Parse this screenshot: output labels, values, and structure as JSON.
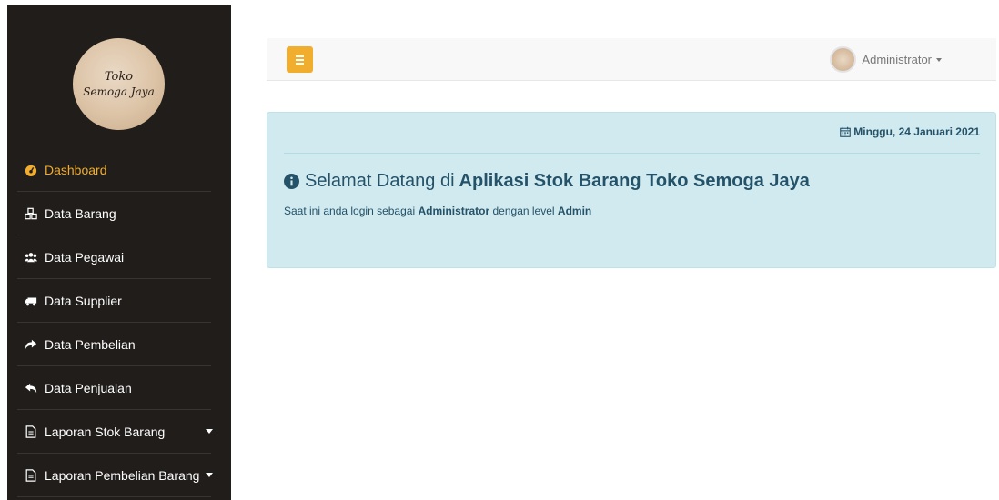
{
  "app": {
    "logo_line1": "Toko",
    "logo_line2": "Semoga Jaya"
  },
  "sidebar": {
    "items": [
      {
        "label": "Dashboard",
        "icon": "dashboard-icon",
        "active": true
      },
      {
        "label": "Data Barang",
        "icon": "cubes-icon"
      },
      {
        "label": "Data Pegawai",
        "icon": "users-icon"
      },
      {
        "label": "Data Supplier",
        "icon": "truck-icon"
      },
      {
        "label": "Data Pembelian",
        "icon": "share-icon"
      },
      {
        "label": "Data Penjualan",
        "icon": "reply-icon"
      },
      {
        "label": "Laporan Stok Barang",
        "icon": "file-icon",
        "dropdown": true
      },
      {
        "label": "Laporan Pembelian Barang",
        "icon": "file-icon",
        "dropdown": true
      }
    ]
  },
  "topbar": {
    "user_name": "Administrator"
  },
  "main": {
    "date": "Minggu, 24 Januari 2021",
    "welcome_prefix": "Selamat Datang di",
    "welcome_app": "Aplikasi Stok Barang Toko Semoga Jaya",
    "login_prefix": "Saat ini anda login sebagai",
    "login_user": "Administrator",
    "login_mid": "dengan level",
    "login_level": "Admin"
  },
  "colors": {
    "sidebar_bg": "#211d1b",
    "accent": "#f0ad2e",
    "info_bg": "#d1eaef",
    "info_text": "#245269"
  }
}
